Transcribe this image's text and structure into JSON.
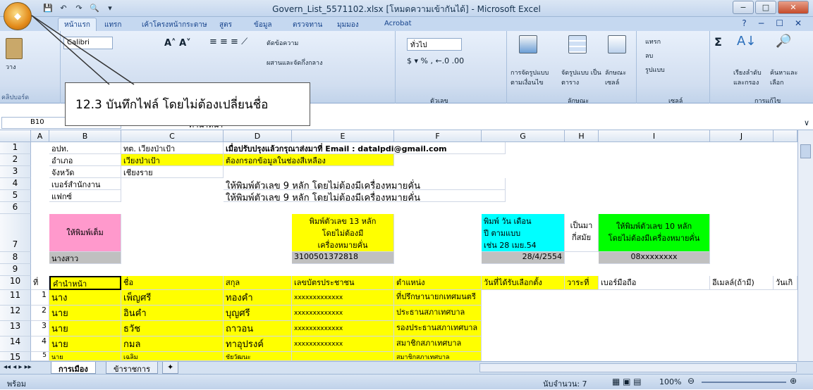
{
  "window": {
    "title": "Govern_List_5571102.xlsx  [โหมดความเข้ากันได้] - Microsoft Excel",
    "office_label": "Office"
  },
  "tabs": [
    "หน้าแรก",
    "แทรก",
    "เค้าโครงหน้ากระดาษ",
    "สูตร",
    "ข้อมูล",
    "ตรวจทาน",
    "มุมมอง",
    "Acrobat"
  ],
  "ribbon": {
    "paste_label": "วาง",
    "clipboard_label": "คลิปบอร์ด",
    "font_name": "Calibri",
    "wrap_text": "ตัดข้อความ",
    "merge_center": "ผสานและจัดกึ่งกลาง",
    "number_format": "ทั่วไป",
    "number_label": "ตัวเลข",
    "cond_format": "การจัดรูปแบบ ตามเงื่อนไข",
    "format_table": "จัดรูปแบบ เป็นตาราง",
    "cell_styles": "ลักษณะ เซลล์",
    "styles_label": "ลักษณะ",
    "insert": "แทรก",
    "delete": "ลบ",
    "format": "รูปแบบ",
    "cells_label": "เซลล์",
    "sort_filter": "เรียงลำดับ และกรอง",
    "find_select": "ค้นหาและ เลือก",
    "editing_label": "การแก้ไข"
  },
  "callout": "12.3  บันทึกไฟล์  โดยไม่ต้องเปลี่ยนชื่อ",
  "formula_bar": {
    "name_box": "B10",
    "formula": "คำนำหน้า"
  },
  "columns": [
    "A",
    "B",
    "C",
    "D",
    "E",
    "F",
    "G",
    "H",
    "I",
    "J"
  ],
  "rows": [
    "1",
    "2",
    "3",
    "4",
    "5",
    "6",
    "7",
    "8",
    "9",
    "10",
    "11",
    "12",
    "13",
    "14",
    "15"
  ],
  "cells": {
    "B1": "อปท.",
    "C1": "ทต. เวียงป่าเป้า",
    "D1": "เมื่อปรับปรุงแล้วกรุณาส่งมาที่ Email : datalpdi@gmail.com",
    "B2": "อำเภอ",
    "C2": "เวียงป่าเป้า",
    "D2": "ต้องกรอกข้อมูลในช่องสีเหลือง",
    "B3": "จังหวัด",
    "C3": "เชียงราย",
    "B4": "เบอร์สำนักงาน",
    "D4": "ให้พิมพ์ตัวเลข 9 หลัก โดยไม่ต้องมีเครื่องหมายคั่น",
    "B5": "แฟกซ์",
    "D5": "ให้พิมพ์ตัวเลข 9 หลัก โดยไม่ต้องมีเครื่องหมายคั่น",
    "B7": "ให้พิมพ์เต็ม",
    "E7": [
      "พิมพ์ตัวเลข  13 หลัก",
      "โดยไม่ต้องมี",
      "เครื่องหมายคั่น"
    ],
    "G7": [
      "พิมพ์  วัน  เดือน",
      "ปี  ตามแบบ",
      "เช่น  28 เมย.54"
    ],
    "H7": [
      "เป็นมา",
      "กี่สมัย"
    ],
    "I7": [
      "ให้พิมพ์ตัวเลข  10 หลัก",
      "โดยไม่ต้องมีเครื่องหมายคั่น"
    ],
    "B8": "นางสาว",
    "E8": "3100501372818",
    "G8": "28/4/2554",
    "I8": "08xxxxxxxx"
  },
  "header_row": [
    "ที่",
    "คำนำหน้า",
    "ชื่อ",
    "สกุล",
    "เลขบัตรประชาชน",
    "ตำแหน่ง",
    "วันที่ได้รับเลือกตั้ง",
    "วาระที่",
    "เบอร์มือถือ",
    "อีเมลล์(ถ้ามี)",
    "วันเกิ"
  ],
  "data_rows": [
    {
      "no": "1",
      "prefix": "นาง",
      "first": "เพ็ญศรี",
      "last": "ทองคำ",
      "id": "xxxxxxxxxxxxx",
      "position": "ที่ปรึกษานายกเทศมนตรี"
    },
    {
      "no": "2",
      "prefix": "นาย",
      "first": "อินคำ",
      "last": "บุญศรี",
      "id": "xxxxxxxxxxxxx",
      "position": "ประธานสภาเทศบาล"
    },
    {
      "no": "3",
      "prefix": "นาย",
      "first": "ธวัช",
      "last": "ถาวอน",
      "id": "xxxxxxxxxxxxx",
      "position": "รองประธานสภาเทศบาล"
    },
    {
      "no": "4",
      "prefix": "นาย",
      "first": "กมล",
      "last": "ทาอุปรงค์",
      "id": "xxxxxxxxxxxxx",
      "position": "สมาชิกสภาเทศบาล"
    },
    {
      "no": "5",
      "prefix": "นาย",
      "first": "เฉลิม",
      "last": "ชัยวัฒนะ",
      "id": "",
      "position": "สมาชิกสภาเทศบาล"
    }
  ],
  "sheets": [
    "การเมือง",
    "ข้าราชการ"
  ],
  "status": {
    "ready": "พร้อม",
    "count": "นับจำนวน: 7",
    "zoom": "100%"
  }
}
